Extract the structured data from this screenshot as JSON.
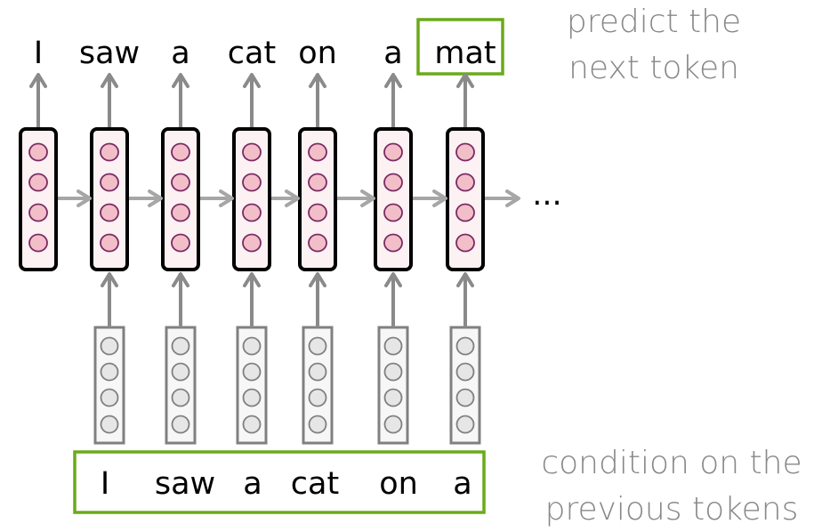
{
  "diagram": {
    "output_tokens": [
      "I",
      "saw",
      "a",
      "cat",
      "on",
      "a",
      "mat"
    ],
    "input_tokens": [
      "I",
      "saw",
      "a",
      "cat",
      "on",
      "a"
    ],
    "highlighted_output_index": 6,
    "continuation": "...",
    "units_per_vector": 4,
    "annotations": {
      "top_line1": "predict the",
      "top_line2": "next token",
      "bottom_line1": "condition on the",
      "bottom_line2": "previous tokens"
    },
    "colors": {
      "highlight": "#6aaa1a",
      "rnn_border": "#000000",
      "rnn_fill": "#fcf1f3",
      "rnn_unit_fill": "#f2bfc9",
      "rnn_unit_stroke": "#7a2a63",
      "emb_border": "#808080",
      "emb_fill": "#f7f7f7",
      "emb_unit_fill": "#e6e6e6",
      "arrow": "#8a8a8a",
      "arrow_h": "#a6a6a6",
      "note_text": "#888888"
    }
  }
}
